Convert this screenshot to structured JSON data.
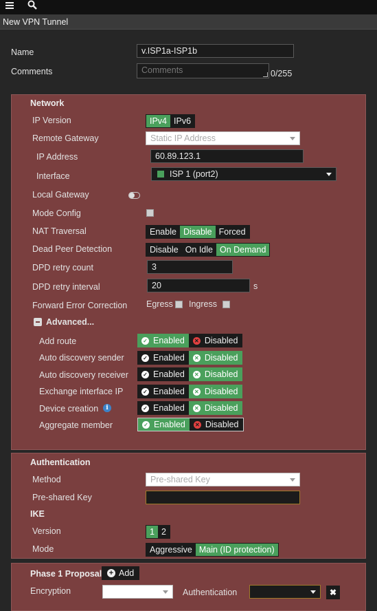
{
  "topbar": {
    "menu_icon": "hamburger-icon",
    "search_icon": "search-icon"
  },
  "title": "New VPN Tunnel",
  "form": {
    "name_label": "Name",
    "name_value": "v.ISP1a-ISP1b",
    "comments_label": "Comments",
    "comments_placeholder": "Comments",
    "comments_count": "0/255"
  },
  "network": {
    "heading": "Network",
    "ip_version_label": "IP Version",
    "ip_version_options": [
      "IPv4",
      "IPv6"
    ],
    "ip_version_selected": "IPv4",
    "remote_gateway_label": "Remote Gateway",
    "remote_gateway_value": "Static IP Address",
    "ip_address_label": "IP Address",
    "ip_address_value": "60.89.123.1",
    "interface_label": "Interface",
    "interface_value": "ISP 1 (port2)",
    "local_gateway_label": "Local Gateway",
    "mode_config_label": "Mode Config",
    "nat_label": "NAT Traversal",
    "nat_options": [
      "Enable",
      "Disable",
      "Forced"
    ],
    "nat_selected": "Disable",
    "dpd_label": "Dead Peer Detection",
    "dpd_options": [
      "Disable",
      "On Idle",
      "On Demand"
    ],
    "dpd_selected": "On Demand",
    "dpd_retry_count_label": "DPD retry count",
    "dpd_retry_count_value": "3",
    "dpd_retry_interval_label": "DPD retry interval",
    "dpd_retry_interval_value": "20",
    "dpd_retry_interval_unit": "s",
    "fec_label": "Forward Error Correction",
    "fec_egress": "Egress",
    "fec_ingress": "Ingress",
    "advanced_label": "Advanced...",
    "enabled": "Enabled",
    "disabled": "Disabled",
    "advanced": [
      {
        "label": "Add route",
        "state": "Enabled"
      },
      {
        "label": "Auto discovery sender",
        "state": "Disabled"
      },
      {
        "label": "Auto discovery receiver",
        "state": "Disabled"
      },
      {
        "label": "Exchange interface IP",
        "state": "Disabled"
      },
      {
        "label": "Device creation",
        "state": "Disabled"
      },
      {
        "label": "Aggregate member",
        "state": "Enabled"
      }
    ]
  },
  "auth": {
    "heading": "Authentication",
    "method_label": "Method",
    "method_value": "Pre-shared Key",
    "psk_label": "Pre-shared Key",
    "ike_heading": "IKE",
    "version_label": "Version",
    "version_options": [
      "1",
      "2"
    ],
    "version_selected": "1",
    "mode_label": "Mode",
    "mode_options": [
      "Aggressive",
      "Main (ID protection)"
    ],
    "mode_selected": "Main (ID protection)"
  },
  "phase1": {
    "heading": "Phase 1 Proposal",
    "add_label": "Add",
    "encryption_label": "Encryption",
    "authentication_label": "Authentication"
  },
  "colors": {
    "panel": "#7a3f3f",
    "accent_green": "#4aa05c",
    "danger_red": "#e34040"
  }
}
